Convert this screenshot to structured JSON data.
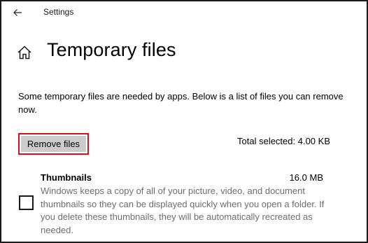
{
  "window": {
    "title": "Settings"
  },
  "icons": {
    "back": "back-arrow-icon",
    "home": "home-icon"
  },
  "page": {
    "title": "Temporary files",
    "description": "Some temporary files are needed by apps. Below is a list of files you can remove now."
  },
  "actions": {
    "remove_label": "Remove files",
    "total_selected": "Total selected: 4.00 KB"
  },
  "categories": [
    {
      "name": "Thumbnails",
      "size": "16.0 MB",
      "checked": false,
      "description": "Windows keeps a copy of all of your picture, video, and document thumbnails so they can be displayed quickly when you open a folder. If you delete these thumbnails, they will be automatically recreated as needed."
    }
  ],
  "colors": {
    "highlight_border": "#d60f1f",
    "button_fill": "#cccccc",
    "secondary_text": "#6e6e6e"
  }
}
